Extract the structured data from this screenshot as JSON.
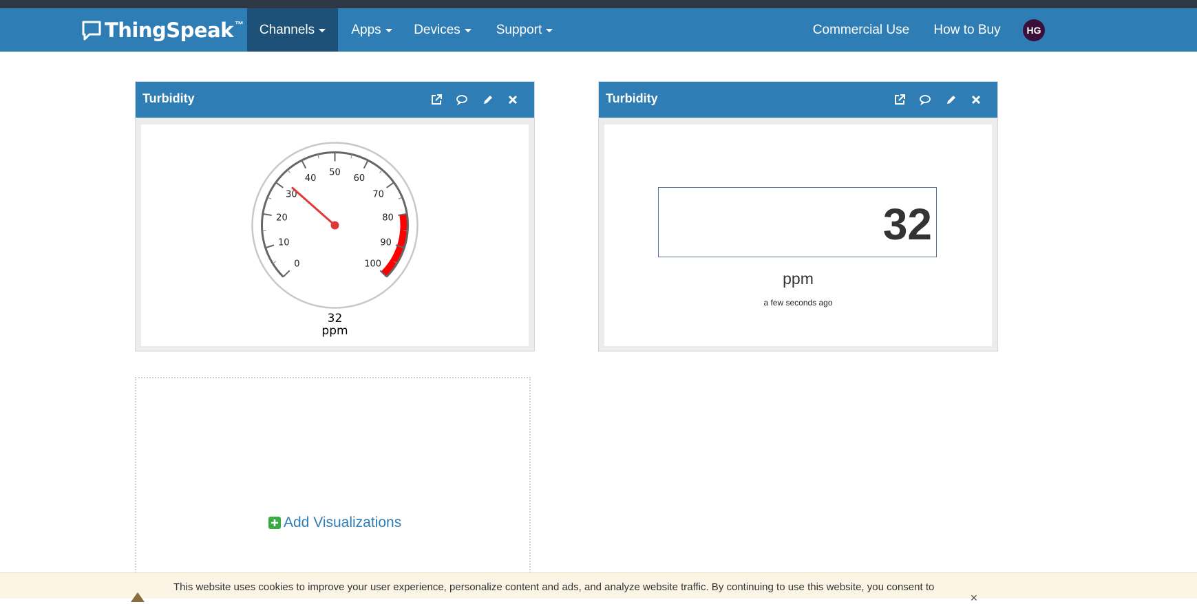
{
  "navbar": {
    "brand": "ThingSpeak",
    "brand_tm": "™",
    "left_items": [
      {
        "label": "Channels",
        "active": true
      },
      {
        "label": "Apps"
      },
      {
        "label": "Devices"
      },
      {
        "label": "Support"
      }
    ],
    "right_items": [
      {
        "label": "Commercial Use"
      },
      {
        "label": "How to Buy"
      }
    ],
    "avatar_initials": "HG"
  },
  "widgets": [
    {
      "title": "Turbidity",
      "type": "gauge",
      "value": "32",
      "unit": "ppm",
      "gauge": {
        "min": 0,
        "max": 100,
        "value": 32,
        "tick_labels": [
          "0",
          "10",
          "20",
          "30",
          "40",
          "50",
          "60",
          "70",
          "80",
          "90",
          "100"
        ],
        "danger_from": 80,
        "danger_to": 100,
        "danger_color": "#ff0000",
        "needle_color": "#dd3b3b"
      }
    },
    {
      "title": "Turbidity",
      "type": "numeric",
      "value": "32",
      "unit": "ppm",
      "updated": "a few seconds ago"
    }
  ],
  "widget_tools": [
    "external-link-icon",
    "comment-icon",
    "pencil-icon",
    "close-icon"
  ],
  "add_visualizations": {
    "label": "Add Visualizations"
  },
  "cookie_banner": {
    "text": "This website uses cookies to improve your user experience, personalize content and ads, and analyze website traffic. By continuing to use this website, you consent to"
  },
  "colors": {
    "navbar": "#2f7db5",
    "navbar_active": "#1d5177",
    "accent_link": "#2f7db5",
    "add_icon": "#3aaa45"
  }
}
